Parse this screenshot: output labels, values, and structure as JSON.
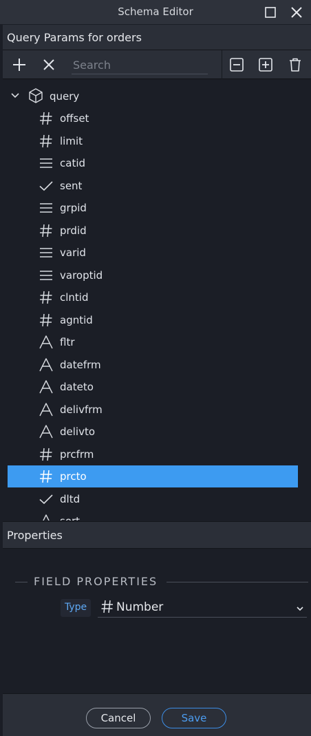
{
  "window": {
    "title": "Schema Editor"
  },
  "panel": {
    "title": "Query Params for orders"
  },
  "toolbar": {
    "search_placeholder": "Search",
    "search_value": ""
  },
  "tree": {
    "root": {
      "label": "query",
      "icon": "cube-icon",
      "expanded": true
    },
    "items": [
      {
        "label": "offset",
        "type": "number"
      },
      {
        "label": "limit",
        "type": "number"
      },
      {
        "label": "catid",
        "type": "array"
      },
      {
        "label": "sent",
        "type": "boolean"
      },
      {
        "label": "grpid",
        "type": "array"
      },
      {
        "label": "prdid",
        "type": "number"
      },
      {
        "label": "varid",
        "type": "array"
      },
      {
        "label": "varoptid",
        "type": "array"
      },
      {
        "label": "clntid",
        "type": "number"
      },
      {
        "label": "agntid",
        "type": "number"
      },
      {
        "label": "fltr",
        "type": "string"
      },
      {
        "label": "datefrm",
        "type": "string"
      },
      {
        "label": "dateto",
        "type": "string"
      },
      {
        "label": "delivfrm",
        "type": "string"
      },
      {
        "label": "delivto",
        "type": "string"
      },
      {
        "label": "prcfrm",
        "type": "number"
      },
      {
        "label": "prcto",
        "type": "number",
        "selected": true
      },
      {
        "label": "dltd",
        "type": "boolean"
      },
      {
        "label": "sort",
        "type": "string"
      }
    ]
  },
  "properties": {
    "title": "Properties",
    "section_title": "FIELD PROPERTIES",
    "type_label": "Type",
    "type_value": "Number"
  },
  "footer": {
    "cancel_label": "Cancel",
    "save_label": "Save"
  },
  "colors": {
    "selection": "#3d9bf1",
    "accent": "#4c9df1",
    "background": "#1b1e26",
    "panel": "#2b2f38"
  }
}
